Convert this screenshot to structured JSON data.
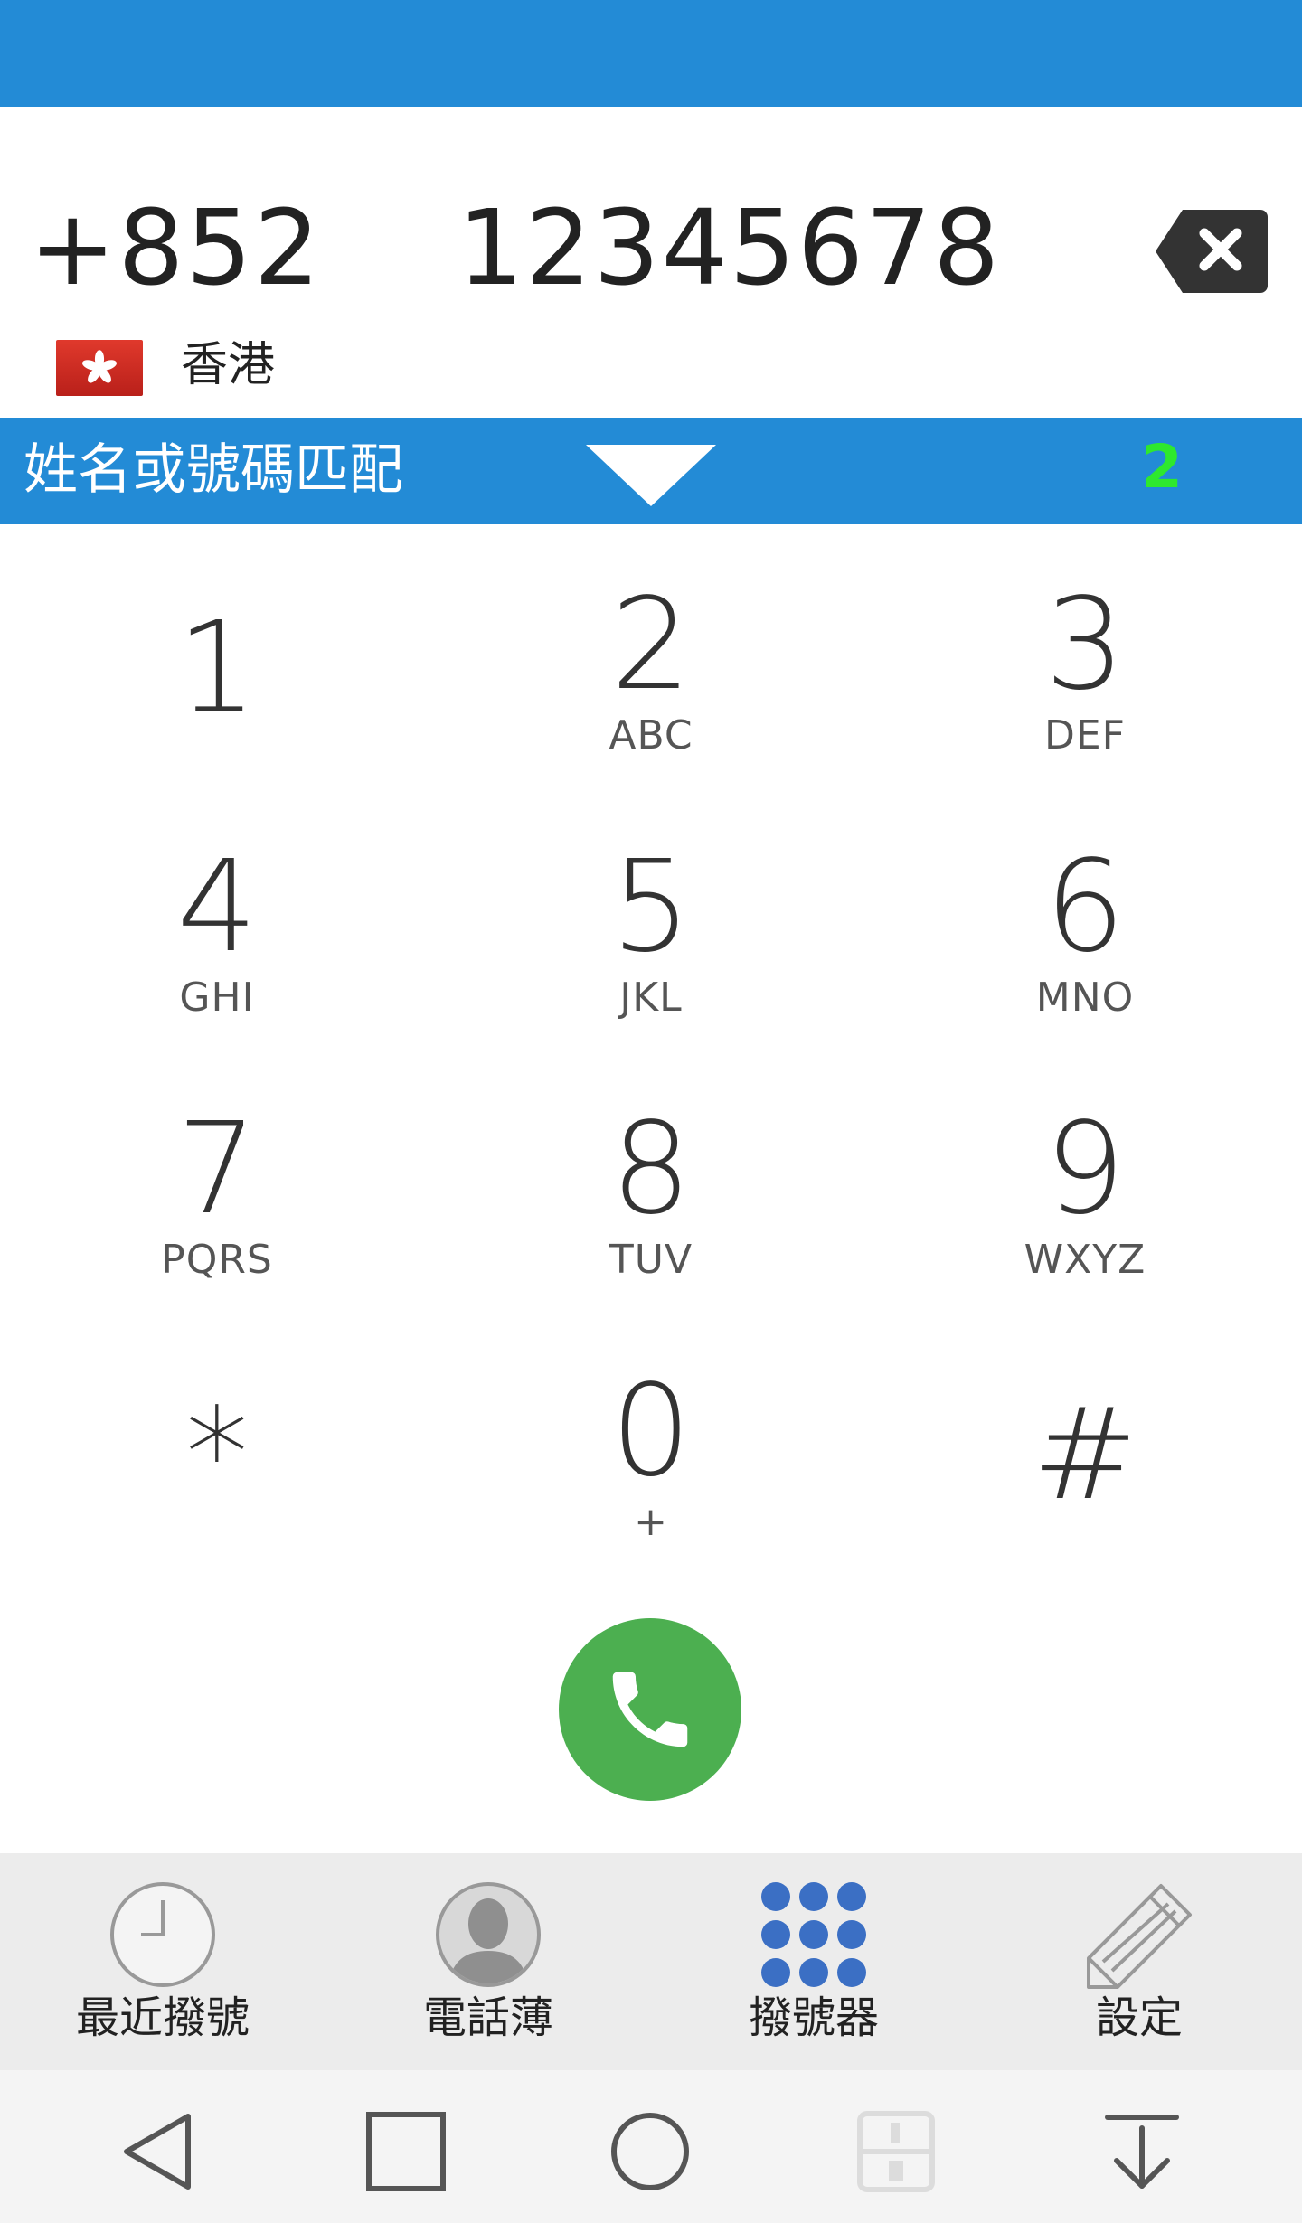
{
  "dial": {
    "country_code": "+852",
    "number": "12345678",
    "region_name": "香港"
  },
  "match_bar": {
    "label": "姓名或號碼匹配",
    "count": "2"
  },
  "keypad": {
    "keys": [
      {
        "digit": "1",
        "letters": ""
      },
      {
        "digit": "2",
        "letters": "ABC"
      },
      {
        "digit": "3",
        "letters": "DEF"
      },
      {
        "digit": "4",
        "letters": "GHI"
      },
      {
        "digit": "5",
        "letters": "JKL"
      },
      {
        "digit": "6",
        "letters": "MNO"
      },
      {
        "digit": "7",
        "letters": "PQRS"
      },
      {
        "digit": "8",
        "letters": "TUV"
      },
      {
        "digit": "9",
        "letters": "WXYZ"
      },
      {
        "digit": "*",
        "letters": ""
      },
      {
        "digit": "0",
        "letters": "+"
      },
      {
        "digit": "#",
        "letters": ""
      }
    ]
  },
  "tabs": [
    {
      "label": "最近撥號",
      "icon": "clock-icon"
    },
    {
      "label": "電話薄",
      "icon": "contact-icon"
    },
    {
      "label": "撥號器",
      "icon": "dialpad-icon"
    },
    {
      "label": "設定",
      "icon": "pencil-icon"
    }
  ],
  "colors": {
    "accent": "#238bd6",
    "call": "#4caf50",
    "match_count": "#2ee82e",
    "dialpad_icon": "#3b6fc4"
  }
}
